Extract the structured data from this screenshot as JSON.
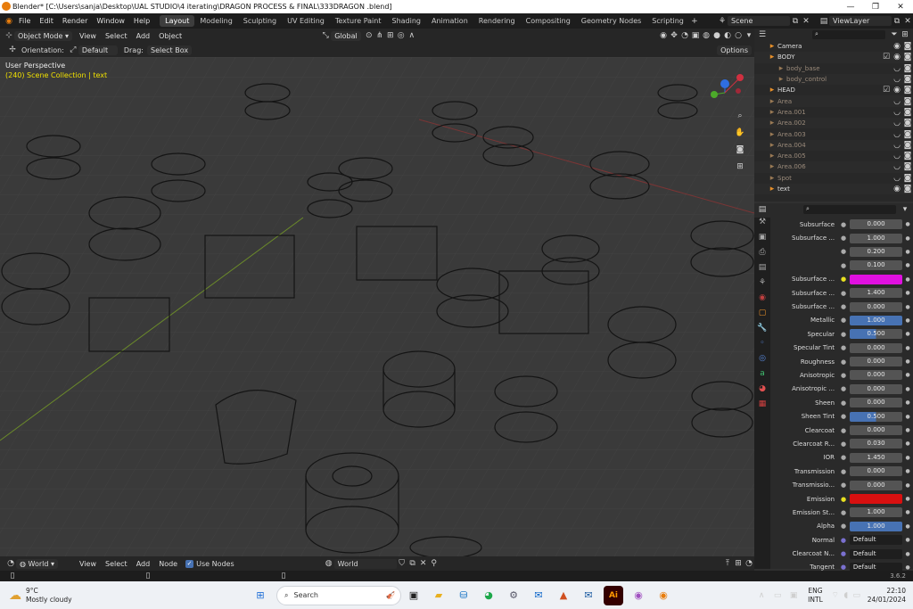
{
  "window": {
    "title": "Blender* [C:\\Users\\sanja\\Desktop\\UAL STUDIO\\4 iterating\\DRAGON PROCESS & FINAL\\333DRAGON .blend]"
  },
  "menu": [
    "File",
    "Edit",
    "Render",
    "Window",
    "Help"
  ],
  "workspaces": [
    {
      "label": "Layout",
      "active": true
    },
    {
      "label": "Modeling"
    },
    {
      "label": "Sculpting"
    },
    {
      "label": "UV Editing"
    },
    {
      "label": "Texture Paint"
    },
    {
      "label": "Shading"
    },
    {
      "label": "Animation"
    },
    {
      "label": "Rendering"
    },
    {
      "label": "Compositing"
    },
    {
      "label": "Geometry Nodes"
    },
    {
      "label": "Scripting"
    }
  ],
  "scene": {
    "name": "Scene",
    "viewlayer": "ViewLayer"
  },
  "viewport_header": {
    "mode": "Object Mode",
    "menus": [
      "View",
      "Select",
      "Add",
      "Object"
    ],
    "transform": "Global"
  },
  "tool_options": {
    "orientation_label": "Orientation:",
    "orientation": "Default",
    "drag_label": "Drag:",
    "drag": "Select Box",
    "options": "Options"
  },
  "viewport": {
    "perspective": "User Perspective",
    "collection": "(240) Scene Collection | text"
  },
  "outliner": {
    "items": [
      {
        "name": "Camera",
        "indent": 1,
        "eye": true
      },
      {
        "name": "BODY",
        "indent": 1,
        "check": true,
        "eye": true
      },
      {
        "name": "body_base",
        "indent": 2,
        "dim": true
      },
      {
        "name": "body_control",
        "indent": 2,
        "dim": true
      },
      {
        "name": "HEAD",
        "indent": 1,
        "check": true,
        "eye": true
      },
      {
        "name": "Area",
        "indent": 1,
        "dim": true
      },
      {
        "name": "Area.001",
        "indent": 1,
        "dim": true
      },
      {
        "name": "Area.002",
        "indent": 1,
        "dim": true
      },
      {
        "name": "Area.003",
        "indent": 1,
        "dim": true
      },
      {
        "name": "Area.004",
        "indent": 1,
        "dim": true
      },
      {
        "name": "Area.005",
        "indent": 1,
        "dim": true
      },
      {
        "name": "Area.006",
        "indent": 1,
        "dim": true
      },
      {
        "name": "Spot",
        "indent": 1,
        "dim": true
      },
      {
        "name": "text",
        "indent": 1,
        "eye": true
      }
    ]
  },
  "properties": {
    "rows": [
      {
        "label": "Subsurface",
        "value": "0.000"
      },
      {
        "label": "Subsurface ...",
        "value": "1.000"
      },
      {
        "label": "",
        "value": "0.200"
      },
      {
        "label": "",
        "value": "0.100"
      },
      {
        "label": "Subsurface ...",
        "value": "",
        "color": "#e010e0"
      },
      {
        "label": "Subsurface ...",
        "value": "1.400"
      },
      {
        "label": "Subsurface ...",
        "value": "0.000"
      },
      {
        "label": "Metallic",
        "value": "1.000",
        "blue": true
      },
      {
        "label": "Specular",
        "value": "0.500",
        "half": true
      },
      {
        "label": "Specular Tint",
        "value": "0.000"
      },
      {
        "label": "Roughness",
        "value": "0.000"
      },
      {
        "label": "Anisotropic",
        "value": "0.000"
      },
      {
        "label": "Anisotropic ...",
        "value": "0.000"
      },
      {
        "label": "Sheen",
        "value": "0.000"
      },
      {
        "label": "Sheen Tint",
        "value": "0.500",
        "half": true
      },
      {
        "label": "Clearcoat",
        "value": "0.000"
      },
      {
        "label": "Clearcoat R...",
        "value": "0.030"
      },
      {
        "label": "IOR",
        "value": "1.450"
      },
      {
        "label": "Transmission",
        "value": "0.000"
      },
      {
        "label": "Transmissio...",
        "value": "0.000"
      },
      {
        "label": "Emission",
        "value": "",
        "color": "#d81010"
      },
      {
        "label": "Emission St...",
        "value": "1.000"
      },
      {
        "label": "Alpha",
        "value": "1.000",
        "blue": true
      },
      {
        "label": "Normal",
        "value": "Default",
        "dark": true
      },
      {
        "label": "Clearcoat N...",
        "value": "Default",
        "dark": true
      },
      {
        "label": "Tangent",
        "value": "Default",
        "dark": true
      }
    ]
  },
  "node_header": {
    "type": "World",
    "menus": [
      "View",
      "Select",
      "Add",
      "Node"
    ],
    "use_nodes": "Use Nodes",
    "world": "World"
  },
  "status": {
    "version": "3.6.2"
  },
  "taskbar": {
    "weather_temp": "9°C",
    "weather_desc": "Mostly cloudy",
    "search": "Search",
    "lang1": "ENG",
    "lang2": "INTL",
    "time": "22:10",
    "date": "24/01/2024"
  }
}
